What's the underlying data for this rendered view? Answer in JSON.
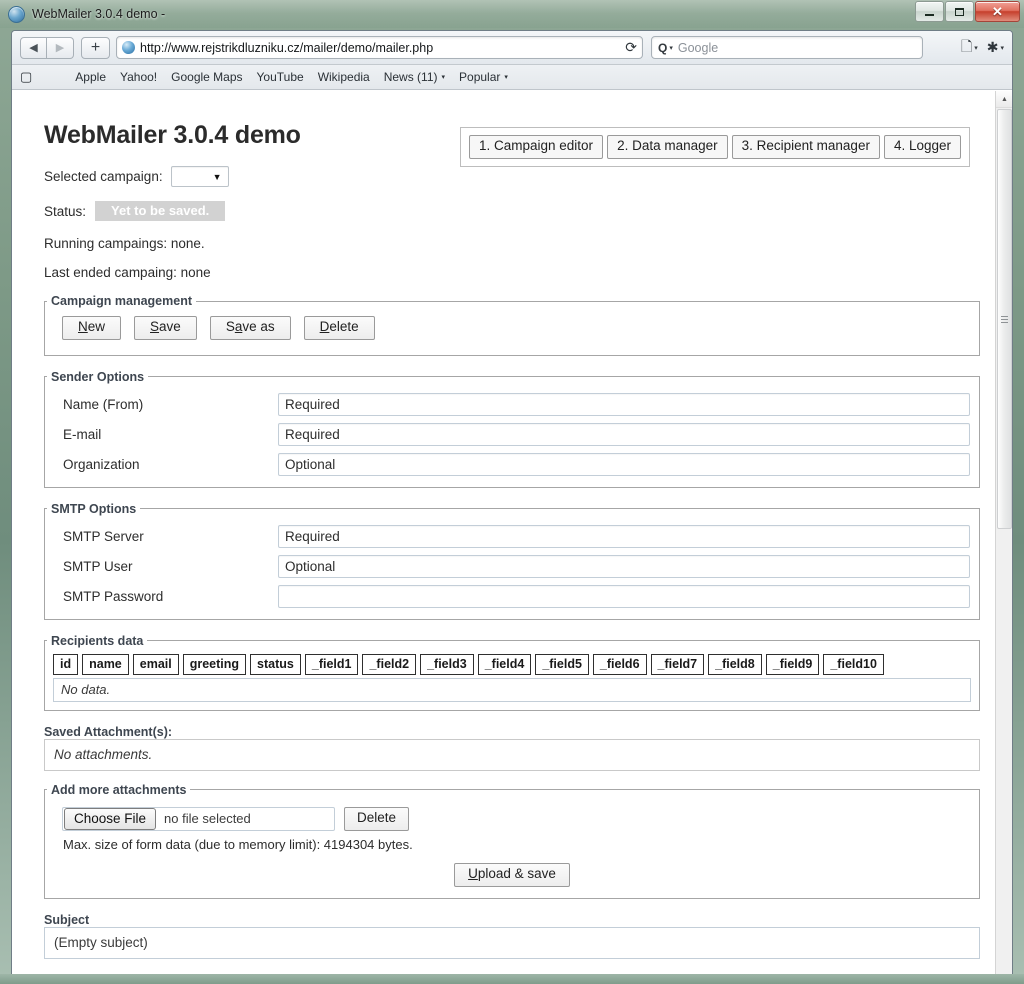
{
  "window": {
    "title": "WebMailer 3.0.4 demo -",
    "icon": "globe-icon",
    "minimize_label": "Minimize",
    "maximize_label": "Maximize",
    "close_label": "✕"
  },
  "browser": {
    "back_glyph": "◀",
    "forward_glyph": "▶",
    "new_tab_glyph": "+",
    "url": "http://www.rejstrikdluzniku.cz/mailer/demo/mailer.php",
    "reload_glyph": "⟳",
    "search_glyph": "Q",
    "search_placeholder": "Google",
    "caret_glyph": "▾",
    "bookmarks": [
      {
        "label": "Apple",
        "has_caret": false
      },
      {
        "label": "Yahoo!",
        "has_caret": false
      },
      {
        "label": "Google Maps",
        "has_caret": false
      },
      {
        "label": "YouTube",
        "has_caret": false
      },
      {
        "label": "Wikipedia",
        "has_caret": false
      },
      {
        "label": "News (11)",
        "has_caret": true
      },
      {
        "label": "Popular",
        "has_caret": true
      }
    ]
  },
  "page": {
    "title": "WebMailer 3.0.4 demo",
    "selected_campaign_label": "Selected campaign:",
    "selected_campaign_value": "",
    "status_label": "Status:",
    "status_value": "Yet to be saved.",
    "running_campaigns": "Running campaings: none.",
    "last_ended_campaign": "Last ended campaing: none",
    "nav_tabs": [
      {
        "label": "1. Campaign editor"
      },
      {
        "label": "2. Data manager"
      },
      {
        "label": "3. Recipient manager"
      },
      {
        "label": "4. Logger"
      }
    ],
    "campaign_management": {
      "legend": "Campaign management",
      "buttons": [
        {
          "pre": "",
          "key": "N",
          "post": "ew"
        },
        {
          "pre": "",
          "key": "S",
          "post": "ave"
        },
        {
          "pre": "S",
          "key": "a",
          "post": "ve as"
        },
        {
          "pre": "",
          "key": "D",
          "post": "elete"
        }
      ]
    },
    "sender_options": {
      "legend": "Sender Options",
      "rows": [
        {
          "label": "Name (From)",
          "value": "Required"
        },
        {
          "label": "E-mail",
          "value": "Required"
        },
        {
          "label": "Organization",
          "value": "Optional"
        }
      ]
    },
    "smtp_options": {
      "legend": "SMTP Options",
      "rows": [
        {
          "label": "SMTP Server",
          "value": "Required"
        },
        {
          "label": "SMTP User",
          "value": "Optional"
        },
        {
          "label": "SMTP Password",
          "value": ""
        }
      ]
    },
    "recipients": {
      "legend": "Recipients data",
      "columns": [
        "id",
        "name",
        "email",
        "greeting",
        "status",
        "_field1",
        "_field2",
        "_field3",
        "_field4",
        "_field5",
        "_field6",
        "_field7",
        "_field8",
        "_field9",
        "_field10"
      ],
      "empty_message": "No data."
    },
    "saved_attachments": {
      "legend": "Saved Attachment(s):",
      "empty_message": "No attachments."
    },
    "add_attachments": {
      "legend": "Add more attachments",
      "choose_file_label": "Choose File",
      "file_name": "no file selected",
      "delete_label": "Delete",
      "note": "Max. size of form data (due to memory limit): 4194304 bytes.",
      "upload_pre": "",
      "upload_key": "U",
      "upload_post": "pload & save"
    },
    "subject": {
      "legend": "Subject",
      "value": "(Empty subject)"
    }
  }
}
